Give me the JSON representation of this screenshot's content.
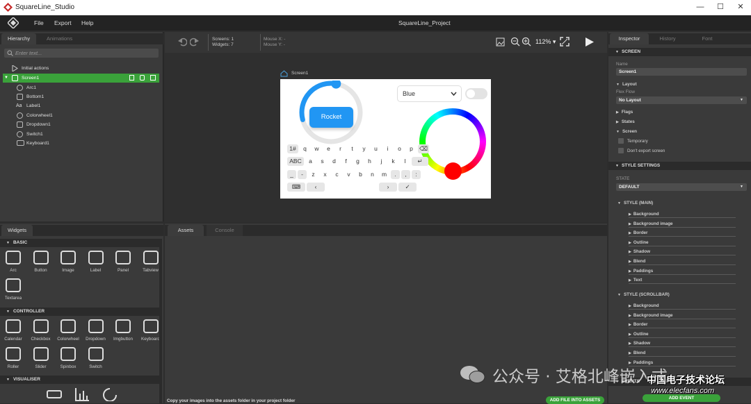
{
  "window": {
    "title": "SquareLine_Studio",
    "minimize": "—",
    "maximize": "☐",
    "close": "✕"
  },
  "menu": {
    "items": [
      "File",
      "Export",
      "Help"
    ],
    "project": "SquareLine_Project"
  },
  "left_tabs": [
    "Hierarchy",
    "Animations"
  ],
  "hierarchy": {
    "search_placeholder": "Enter text...",
    "initial_actions": "Initial actions",
    "screen": "Screen1",
    "children": [
      "Arc1",
      "Bottom1",
      "Label1",
      "Colorwheel1",
      "Dropdown1",
      "Switch1",
      "Keyboard1"
    ]
  },
  "toolbar": {
    "screens_label": "Screens:",
    "screens_value": "1",
    "widgets_label": "Widgets:",
    "widgets_value": "7",
    "mousex_label": "Mouse X:",
    "mousex_value": "-",
    "mousey_label": "Mouse Y:",
    "mousey_value": "-",
    "zoom": "112%"
  },
  "canvas": {
    "screen_label": "Screen1",
    "button_label": "Rocket",
    "dropdown_value": "Blue",
    "keyboard": {
      "row1": [
        "1#",
        "q",
        "w",
        "e",
        "r",
        "t",
        "y",
        "u",
        "i",
        "o",
        "p",
        "⌫"
      ],
      "row2": [
        "ABC",
        "a",
        "s",
        "d",
        "f",
        "g",
        "h",
        "j",
        "k",
        "l",
        "↵"
      ],
      "row3": [
        "_",
        "-",
        "z",
        "x",
        "c",
        "v",
        "b",
        "n",
        "m",
        ".",
        ",",
        ":"
      ],
      "row4": [
        "⌨",
        "‹",
        "",
        "›",
        "✓"
      ]
    },
    "arc_fraction": 0.75
  },
  "widgets": {
    "tab": "Widgets",
    "basic_title": "BASIC",
    "basic": [
      "Arc",
      "Button",
      "Image",
      "Label",
      "Panel",
      "Tabview",
      "Textarea"
    ],
    "controller_title": "CONTROLLER",
    "controller": [
      "Calendar",
      "Checkbox",
      "Colorwheel",
      "Dropdown",
      "Imgbutton",
      "Keyboard",
      "Roller",
      "Slider",
      "Spinbox",
      "Switch"
    ],
    "visualiser_title": "VISUALISER"
  },
  "bottom_tabs": [
    "Assets",
    "Console"
  ],
  "assets": {
    "hint": "Copy your images into the assets folder in your project folder",
    "add_button": "ADD FILE INTO ASSETS"
  },
  "right_tabs": [
    "Inspector",
    "History",
    "Font Manager"
  ],
  "inspector": {
    "screen_section": "SCREEN",
    "name_label": "Name",
    "name_value": "Screen1",
    "layout": "Layout",
    "flex_flow": "Flex Flow",
    "no_layout": "No Layout",
    "flags": "Flags",
    "states": "States",
    "screen_sub": "Screen",
    "temporary": "Temporary",
    "dont_export": "Don't export screen",
    "style_settings": "STYLE SETTINGS",
    "state_label": "STATE",
    "state_value": "DEFAULT",
    "style_main": "STYLE (MAIN)",
    "main_items": [
      "Background",
      "Background image",
      "Border",
      "Outline",
      "Shadow",
      "Blend",
      "Paddings",
      "Text"
    ],
    "style_scrollbar": "STYLE (SCROLLBAR)",
    "scroll_items": [
      "Background",
      "Background image",
      "Border",
      "Outline",
      "Shadow",
      "Blend",
      "Paddings"
    ],
    "events": "EVENTS",
    "add_event": "ADD EVENT"
  },
  "watermark": {
    "text": "公众号 · 艾格北峰嵌入式",
    "corner": "中国电子技术论坛",
    "url": "www.elecfans.com"
  },
  "colors": {
    "accent": "#3aa23a",
    "button_blue": "#2196f3",
    "knob_red": "#ff0000"
  }
}
